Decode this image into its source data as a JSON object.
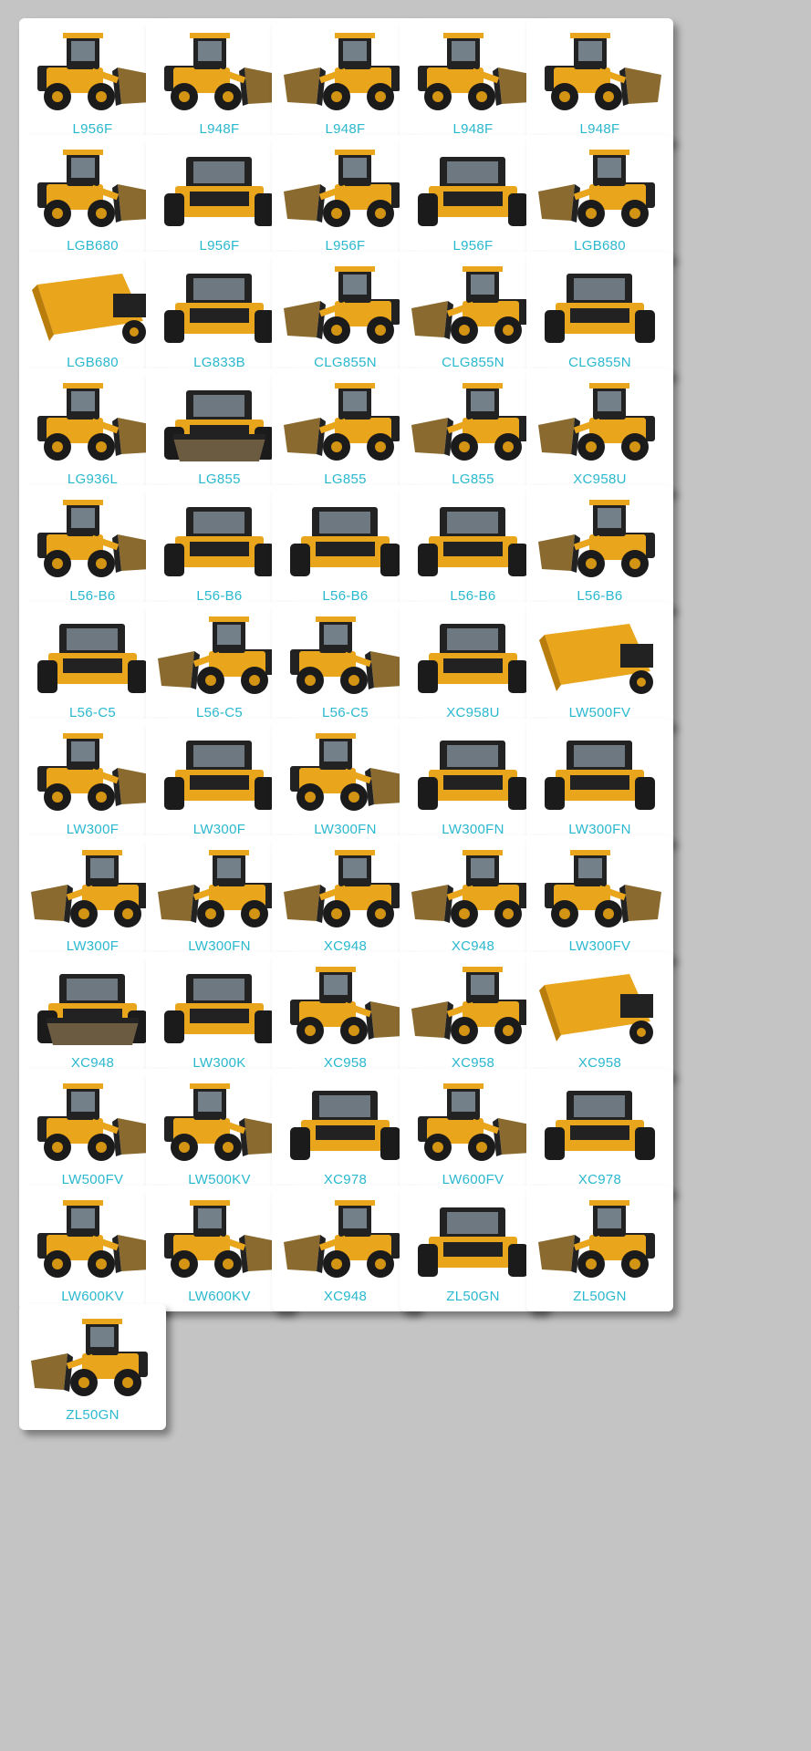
{
  "page": {
    "background": "#c4c4c4",
    "card_background": "#ffffff",
    "label_color": "#2ab8cf"
  },
  "machine_icon": "wheel-loader-photo",
  "items": [
    {
      "label": "L956F",
      "view": "front-left",
      "bucket": "front"
    },
    {
      "label": "L948F",
      "view": "left",
      "bucket": "front"
    },
    {
      "label": "L948F",
      "view": "right",
      "bucket": "front"
    },
    {
      "label": "L948F",
      "view": "left",
      "bucket": "front"
    },
    {
      "label": "L948F",
      "view": "left",
      "bucket": "front"
    },
    {
      "label": "LGB680",
      "view": "left",
      "bucket": "front"
    },
    {
      "label": "L956F",
      "view": "rear",
      "bucket": "none"
    },
    {
      "label": "L956F",
      "view": "right",
      "bucket": "front"
    },
    {
      "label": "L956F",
      "view": "rear",
      "bucket": "none"
    },
    {
      "label": "LGB680",
      "view": "right",
      "bucket": "front"
    },
    {
      "label": "LGB680",
      "view": "bucket",
      "bucket": "front"
    },
    {
      "label": "LG833B",
      "view": "rear",
      "bucket": "none"
    },
    {
      "label": "CLG855N",
      "view": "right",
      "bucket": "front"
    },
    {
      "label": "CLG855N",
      "view": "right",
      "bucket": "front"
    },
    {
      "label": "CLG855N",
      "view": "rear",
      "bucket": "none"
    },
    {
      "label": "LG936L",
      "view": "left",
      "bucket": "front"
    },
    {
      "label": "LG855",
      "view": "front",
      "bucket": "front"
    },
    {
      "label": "LG855",
      "view": "right",
      "bucket": "front"
    },
    {
      "label": "LG855",
      "view": "right",
      "bucket": "front"
    },
    {
      "label": "XC958U",
      "view": "right",
      "bucket": "front"
    },
    {
      "label": "L56-B6",
      "view": "left",
      "bucket": "front"
    },
    {
      "label": "L56-B6",
      "view": "rear",
      "bucket": "none"
    },
    {
      "label": "L56-B6",
      "view": "rear",
      "bucket": "none"
    },
    {
      "label": "L56-B6",
      "view": "rear",
      "bucket": "none"
    },
    {
      "label": "L56-B6",
      "view": "right",
      "bucket": "front"
    },
    {
      "label": "L56-C5",
      "view": "rear",
      "bucket": "none"
    },
    {
      "label": "L56-C5",
      "view": "right",
      "bucket": "front"
    },
    {
      "label": "L56-C5",
      "view": "left",
      "bucket": "front"
    },
    {
      "label": "XC958U",
      "view": "rear",
      "bucket": "none"
    },
    {
      "label": "LW500FV",
      "view": "bucket",
      "bucket": "front"
    },
    {
      "label": "LW300F",
      "view": "left",
      "bucket": "front"
    },
    {
      "label": "LW300F",
      "view": "rear",
      "bucket": "none"
    },
    {
      "label": "LW300FN",
      "view": "left",
      "bucket": "front"
    },
    {
      "label": "LW300FN",
      "view": "rear",
      "bucket": "none"
    },
    {
      "label": "LW300FN",
      "view": "rear",
      "bucket": "none"
    },
    {
      "label": "LW300F",
      "view": "right",
      "bucket": "front"
    },
    {
      "label": "LW300FN",
      "view": "right",
      "bucket": "front"
    },
    {
      "label": "XC948",
      "view": "right",
      "bucket": "front"
    },
    {
      "label": "XC948",
      "view": "right",
      "bucket": "front"
    },
    {
      "label": "LW300FV",
      "view": "left",
      "bucket": "front"
    },
    {
      "label": "XC948",
      "view": "front",
      "bucket": "front"
    },
    {
      "label": "LW300K",
      "view": "rear",
      "bucket": "none"
    },
    {
      "label": "XC958",
      "view": "left",
      "bucket": "front"
    },
    {
      "label": "XC958",
      "view": "right",
      "bucket": "front"
    },
    {
      "label": "XC958",
      "view": "bucket",
      "bucket": "front"
    },
    {
      "label": "LW500FV",
      "view": "left",
      "bucket": "front"
    },
    {
      "label": "LW500KV",
      "view": "left",
      "bucket": "front"
    },
    {
      "label": "XC978",
      "view": "rear",
      "bucket": "none"
    },
    {
      "label": "LW600FV",
      "view": "left",
      "bucket": "front"
    },
    {
      "label": "XC978",
      "view": "rear",
      "bucket": "none"
    },
    {
      "label": "LW600KV",
      "view": "left",
      "bucket": "front"
    },
    {
      "label": "LW600KV",
      "view": "left",
      "bucket": "front"
    },
    {
      "label": "XC948",
      "view": "right",
      "bucket": "front"
    },
    {
      "label": "ZL50GN",
      "view": "rear",
      "bucket": "none"
    },
    {
      "label": "ZL50GN",
      "view": "right",
      "bucket": "front"
    },
    {
      "label": "ZL50GN",
      "view": "right",
      "bucket": "front"
    }
  ]
}
